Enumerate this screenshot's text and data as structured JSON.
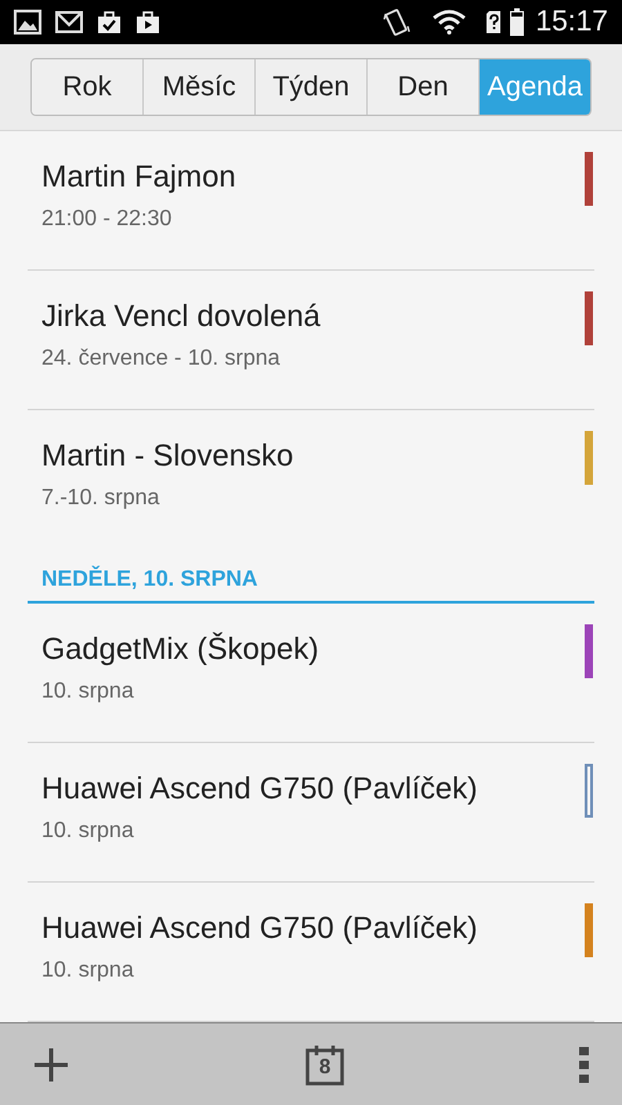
{
  "status_bar": {
    "time": "15:17"
  },
  "tabs": [
    {
      "label": "Rok",
      "selected": false
    },
    {
      "label": "Měsíc",
      "selected": false
    },
    {
      "label": "Týden",
      "selected": false
    },
    {
      "label": "Den",
      "selected": false
    },
    {
      "label": "Agenda",
      "selected": true
    }
  ],
  "agenda": [
    {
      "kind": "event",
      "title": "Martin Fajmon",
      "when": "21:00 - 22:30",
      "color": "#b0413a",
      "outlined": false
    },
    {
      "kind": "event",
      "title": "Jirka Vencl dovolená",
      "when": "24. července - 10. srpna",
      "color": "#b0413a",
      "outlined": false
    },
    {
      "kind": "event",
      "title": "Martin - Slovensko",
      "when": "7.-10. srpna",
      "color": "#d4a53a",
      "outlined": false
    },
    {
      "kind": "header",
      "title": "NEDĚLE, 10. SRPNA"
    },
    {
      "kind": "event",
      "title": "GadgetMix (Škopek)",
      "when": "10. srpna",
      "color": "#9c44b8",
      "outlined": false
    },
    {
      "kind": "event",
      "title": "Huawei Ascend G750 (Pavlíček)",
      "when": "10. srpna",
      "color": "#6f8fb8",
      "outlined": true
    },
    {
      "kind": "event",
      "title": "Huawei Ascend G750 (Pavlíček)",
      "when": "10. srpna",
      "color": "#d4821e",
      "outlined": false
    }
  ],
  "bottom_bar": {
    "calendar_day": "8"
  }
}
